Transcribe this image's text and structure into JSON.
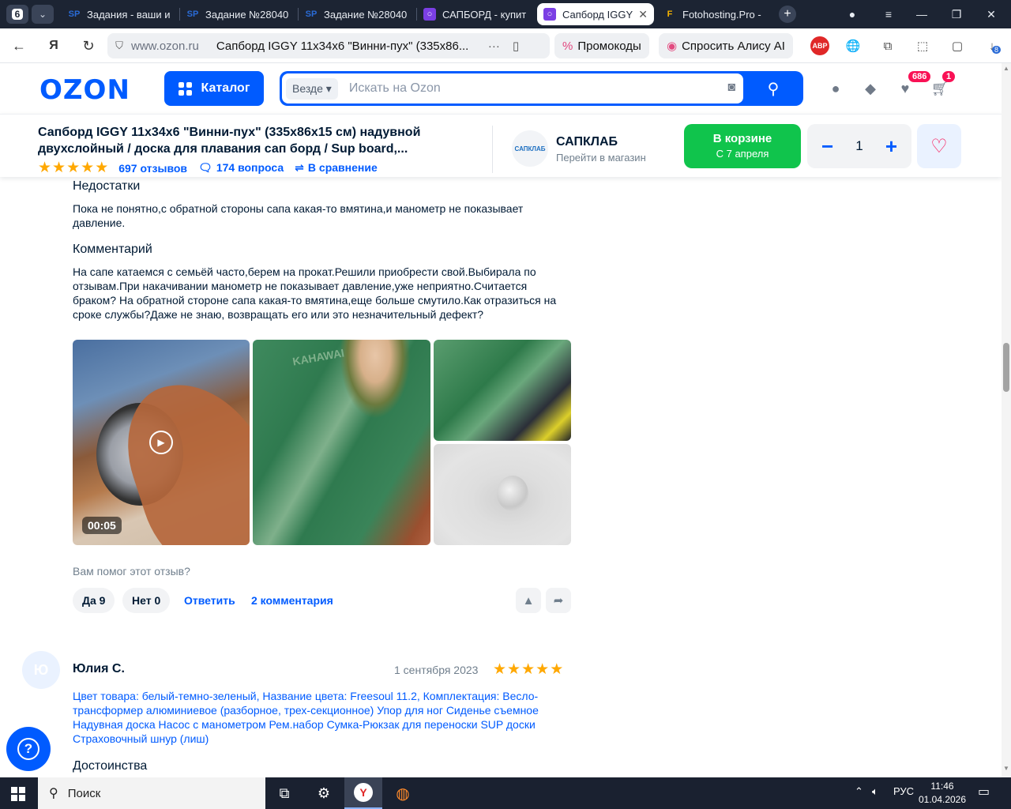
{
  "browser": {
    "tab_count": "6",
    "tabs": [
      {
        "label": "Задания - ваши и",
        "icon": "SP"
      },
      {
        "label": "Задание №28040",
        "icon": "SP"
      },
      {
        "label": "Задание №28040",
        "icon": "SP"
      },
      {
        "label": "САПБОРД - купит",
        "icon": "ozon"
      },
      {
        "label": "Сапборд IGGY",
        "icon": "ozon",
        "active": true
      },
      {
        "label": "Fotohosting.Pro -",
        "icon": "F"
      }
    ],
    "address": {
      "domain": "www.ozon.ru",
      "page_title": "Сапборд IGGY 11x34x6 \"Винни-пух\" (335х86..."
    },
    "chips": {
      "promocodes": "Промокоды",
      "alice": "Спросить Алису AI"
    },
    "abp_label": "ABP",
    "downloads_count": "8"
  },
  "header": {
    "logo": "OZON",
    "catalog_label": "Каталог",
    "search_scope": "Везде",
    "search_placeholder": "Искать на Ozon",
    "favorites_badge": "686",
    "cart_badge": "1"
  },
  "product": {
    "title": "Сапборд IGGY 11x34x6 \"Винни-пух\" (335х86х15 см) надувной двухслойный / доска для плавания сап борд / Sup board,...",
    "rating_stars": 5,
    "reviews_link": "697 отзывов",
    "questions_link": "174 вопроса",
    "compare_link": "В сравнение",
    "shop_logo_text": "САПКЛАБ",
    "shop_name": "САПКЛАБ",
    "shop_sub": "Перейти в магазин",
    "cart_label": "В корзине",
    "cart_sub": "С 7 апреля",
    "quantity": "1"
  },
  "review1": {
    "cons_heading": "Недостатки",
    "cons_text": "Пока не понятно,с обратной стороны сапа какая-то вмятина,и манометр не показывает давление.",
    "comment_heading": "Комментарий",
    "comment_text": "На сапе катаемся с семьёй часто,берем на прокат.Решили приобрести свой.Выбирала по отзывам.При накачивании манометр не показывает давление,уже неприятно.Считается браком? На обратной стороне сапа какая-то вмятина,еще больше смутило.Как отразиться на сроке службы?Даже не знаю, возвращать его или это незначительный дефект?",
    "video_duration": "00:05",
    "image_text": "KAHAWAI",
    "helpful_question": "Вам помог этот отзыв?",
    "yes_label": "Да 9",
    "no_label": "Нет 0",
    "reply_label": "Ответить",
    "comments_label": "2 комментария"
  },
  "review2": {
    "avatar_letter": "Ю",
    "author": "Юлия С.",
    "date": "1 сентября 2023",
    "rating_stars": 5,
    "variant": "Цвет товара: белый-темно-зеленый, Название цвета: Freesoul 11.2, Комплектация: Весло-трансформер алюминиевое (разборное, трех-секционное) Упор для ног Сиденье съемное Надувная доска Насос с манометром Рем.набор Сумка-Рюкзак для переноски SUP доски Страховочный шнур (лиш)",
    "pros_heading": "Достоинства"
  },
  "taskbar": {
    "search_label": "Поиск",
    "language": "РУС",
    "time": "11:46",
    "date": "01.04.2026"
  },
  "colors": {
    "accent": "#005bff",
    "cart_green": "#10c44c",
    "star": "#ffa800",
    "badge": "#f91155"
  }
}
